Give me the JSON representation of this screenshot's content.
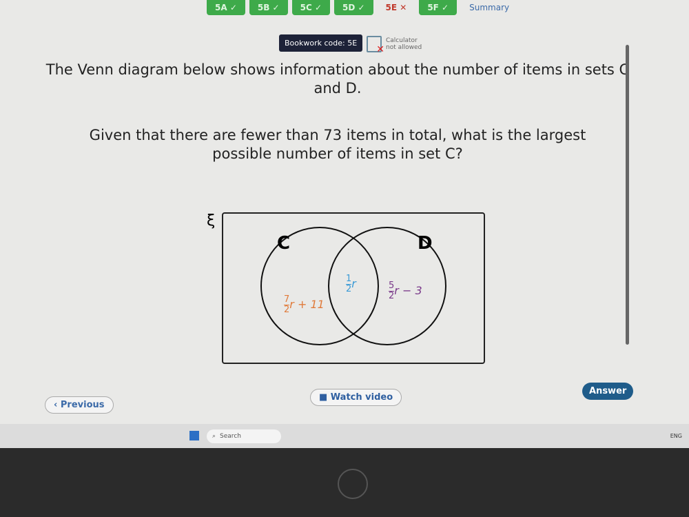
{
  "tabs": [
    {
      "label": "5A",
      "status": "correct"
    },
    {
      "label": "5B",
      "status": "correct"
    },
    {
      "label": "5C",
      "status": "correct"
    },
    {
      "label": "5D",
      "status": "correct"
    },
    {
      "label": "5E",
      "status": "incorrect"
    },
    {
      "label": "5F",
      "status": "correct"
    },
    {
      "label": "Summary"
    }
  ],
  "bookwork": "Bookwork code: 5E",
  "calculator": {
    "line1": "Calculator",
    "line2": "not allowed"
  },
  "question": {
    "p1": "The Venn diagram below shows information about the number of items in sets C and D.",
    "p2": "Given that there are fewer than 73 items in total, what is the largest possible number of items in set C?"
  },
  "venn": {
    "universal": "ξ",
    "set_c": "C",
    "set_d": "D",
    "c_only": {
      "num": "7",
      "den": "2",
      "rest": "r + 11",
      "color": "#e07a3a"
    },
    "both": {
      "num": "1",
      "den": "2",
      "rest": "r",
      "color": "#3a9ad6"
    },
    "d_only": {
      "num": "5",
      "den": "2",
      "rest": "r − 3",
      "color": "#7a3a8a"
    }
  },
  "buttons": {
    "previous": "‹ Previous",
    "watch": "■ Watch video",
    "answer": "Answer"
  },
  "taskbar": {
    "search": "Search",
    "lang": "ENG"
  },
  "brand": "hp"
}
